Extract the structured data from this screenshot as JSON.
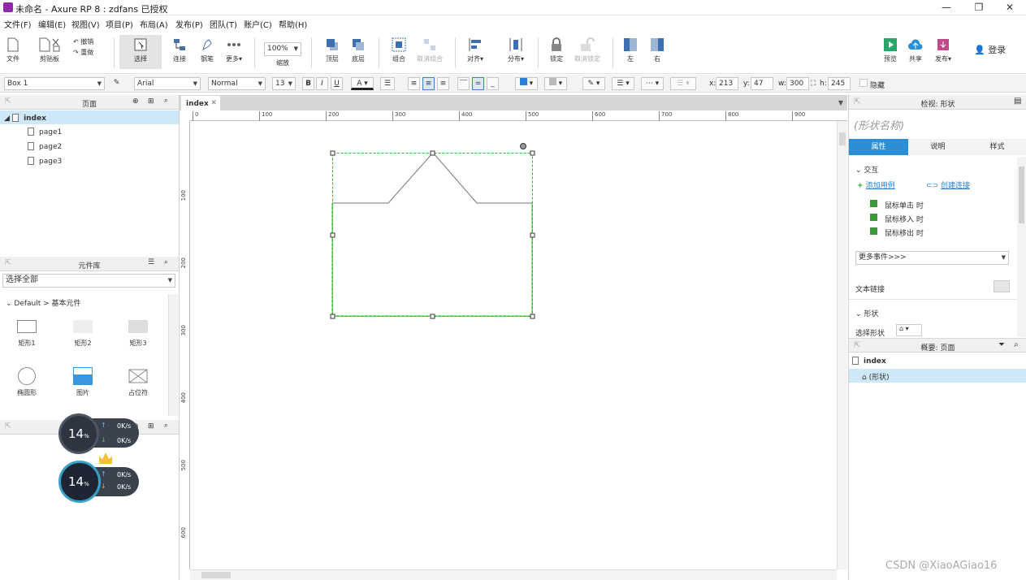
{
  "window": {
    "title": "未命名 - Axure RP 8 : zdfans 已授权",
    "min": "—",
    "max": "❐",
    "close": "✕"
  },
  "menu": [
    "文件(F)",
    "编辑(E)",
    "视图(V)",
    "项目(P)",
    "布局(A)",
    "发布(P)",
    "团队(T)",
    "账户(C)",
    "帮助(H)"
  ],
  "toolbar": {
    "file": "文件",
    "clipboard": "剪贴板",
    "undo": "撤销",
    "redo": "重做",
    "select": "选择",
    "connect": "连接",
    "pen": "钢笔",
    "more": "更多▾",
    "zoom_value": "100%",
    "zoom": "缩放",
    "top": "顶层",
    "bottom": "底层",
    "group": "组合",
    "ungroup": "取消组合",
    "align": "对齐▾",
    "distribute": "分布▾",
    "lock": "锁定",
    "unlock": "取消锁定",
    "left": "左",
    "right": "右",
    "preview": "预览",
    "share": "共享",
    "publish": "发布▾",
    "login": "登录"
  },
  "format": {
    "name": "Box 1",
    "font": "Arial",
    "style": "Normal",
    "size": "13",
    "bold": "B",
    "italic": "I",
    "underline": "U",
    "x_label": "x:",
    "x": "213",
    "y_label": "y:",
    "y": "47",
    "w_label": "w:",
    "w": "300",
    "h_label": "h:",
    "h": "245",
    "hidden": "隐藏"
  },
  "pages_panel": {
    "title": "页面",
    "root": "index",
    "pages": [
      "page1",
      "page2",
      "page3"
    ]
  },
  "library_panel": {
    "title": "元件库",
    "filter": "选择全部",
    "group": "Default > 基本元件",
    "widgets": [
      "矩形1",
      "矩形2",
      "矩形3",
      "椭圆形",
      "图片",
      "占位符"
    ]
  },
  "overlay": {
    "percent1": "14",
    "percent2": "14",
    "unit": "%",
    "up1": "0K/s",
    "down1": "0K/s",
    "up2": "0K/s",
    "down2": "0K/s"
  },
  "canvas": {
    "tab": "index",
    "hticks": [
      "0",
      "100",
      "200",
      "300",
      "400",
      "500",
      "600",
      "700",
      "800",
      "900"
    ],
    "vticks": [
      "100",
      "200",
      "300",
      "400",
      "500",
      "600"
    ]
  },
  "inspector": {
    "title": "检视: 形状",
    "shape_name": "(形状名称)",
    "tabs": [
      "属性",
      "说明",
      "样式"
    ],
    "interaction": "交互",
    "add_case": "添加用例",
    "create_link": "创建连接",
    "events": [
      "鼠标单击 时",
      "鼠标移入 时",
      "鼠标移出 时"
    ],
    "more_events": "更多事件>>>",
    "text_link": "文本链接",
    "shape_section": "形状",
    "select_shape": "选择形状"
  },
  "outline": {
    "title": "概要: 页面",
    "root": "index",
    "item": "(形状)"
  },
  "watermark": "CSDN @XiaoAGiao16"
}
